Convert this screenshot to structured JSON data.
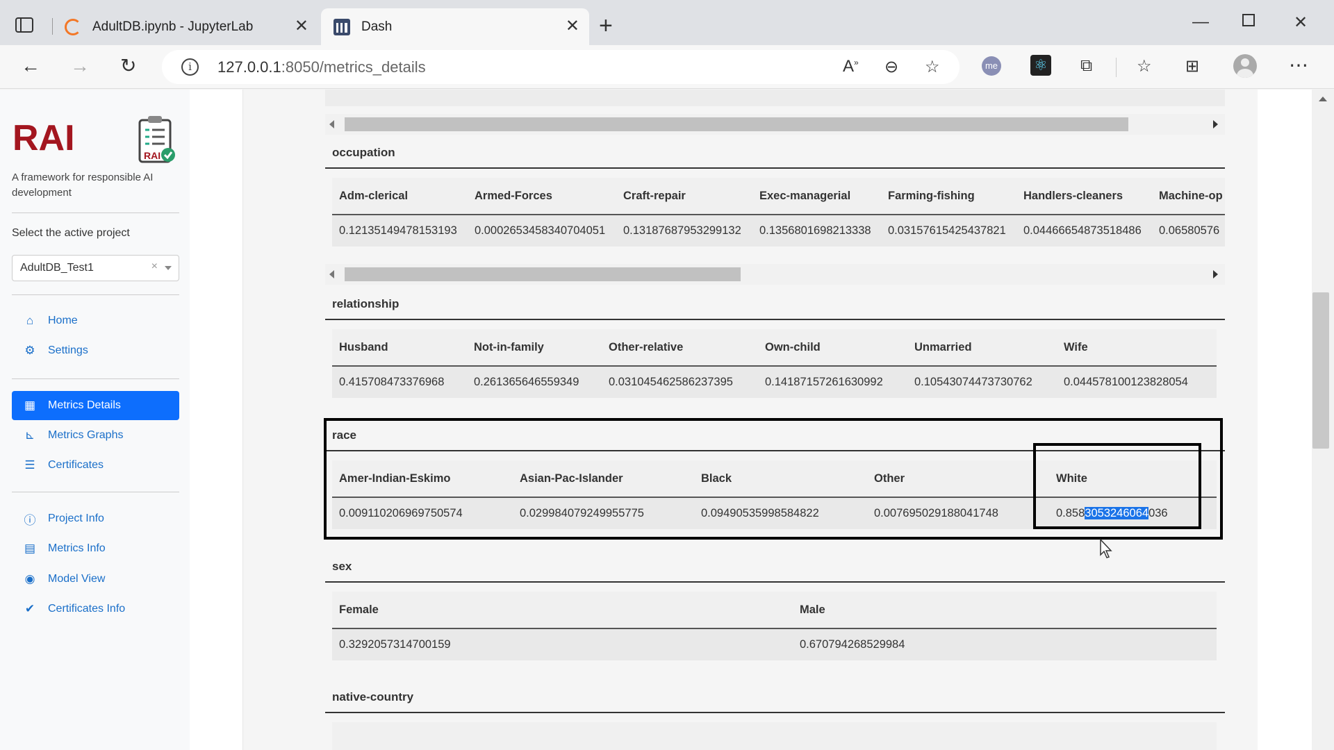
{
  "browser": {
    "tabs": [
      {
        "title": "AdultDB.ipynb - JupyterLab",
        "active": false
      },
      {
        "title": "Dash",
        "active": true
      }
    ],
    "url": "127.0.0.1:8050/metrics_details",
    "url_host": "127.0.0.1",
    "url_rest": ":8050/metrics_details",
    "ext_me_label": "me"
  },
  "sidebar": {
    "logo": "RAI",
    "tagline": "A framework for responsible AI development",
    "select_label": "Select the active project",
    "project": "AdultDB_Test1",
    "nav": [
      {
        "label": "Home",
        "icon": "home-icon"
      },
      {
        "label": "Settings",
        "icon": "gear-icon"
      },
      {
        "label": "Metrics Details",
        "icon": "table-icon",
        "active": true
      },
      {
        "label": "Metrics Graphs",
        "icon": "chart-icon"
      },
      {
        "label": "Certificates",
        "icon": "list-check-icon"
      },
      {
        "label": "Project Info",
        "icon": "info-circle-icon"
      },
      {
        "label": "Metrics Info",
        "icon": "file-icon"
      },
      {
        "label": "Model View",
        "icon": "eye-icon"
      },
      {
        "label": "Certificates Info",
        "icon": "check-double-icon"
      }
    ]
  },
  "sections": {
    "occupation": {
      "title": "occupation",
      "headers": [
        "Adm-clerical",
        "Armed-Forces",
        "Craft-repair",
        "Exec-managerial",
        "Farming-fishing",
        "Handlers-cleaners",
        "Machine-op"
      ],
      "values": [
        "0.12135149478153193",
        "0.0002653458340704051",
        "0.13187687953299132",
        "0.1356801698213338",
        "0.03157615425437821",
        "0.04466654873518486",
        "0.06580576"
      ]
    },
    "relationship": {
      "title": "relationship",
      "headers": [
        "Husband",
        "Not-in-family",
        "Other-relative",
        "Own-child",
        "Unmarried",
        "Wife"
      ],
      "values": [
        "0.415708473376968",
        "0.261365646559349",
        "0.031045462586237395",
        "0.14187157261630992",
        "0.10543074473730762",
        "0.044578100123828054"
      ]
    },
    "race": {
      "title": "race",
      "headers": [
        "Amer-Indian-Eskimo",
        "Asian-Pac-Islander",
        "Black",
        "Other",
        "White"
      ],
      "values": [
        "0.009110206969750574",
        "0.029984079249955775",
        "0.09490535998584822",
        "0.007695029188041748"
      ],
      "white_prefix": "0.858",
      "white_selected": "3053246064",
      "white_suffix": "036"
    },
    "sex": {
      "title": "sex",
      "headers": [
        "Female",
        "Male"
      ],
      "values": [
        "0.3292057314700159",
        "0.670794268529984"
      ]
    },
    "native_country": {
      "title": "native-country"
    }
  },
  "colors": {
    "brand_red": "#a3161f",
    "nav_active": "#0d6efd",
    "link_blue": "#1a6fc9",
    "selection": "#1a73e8"
  }
}
